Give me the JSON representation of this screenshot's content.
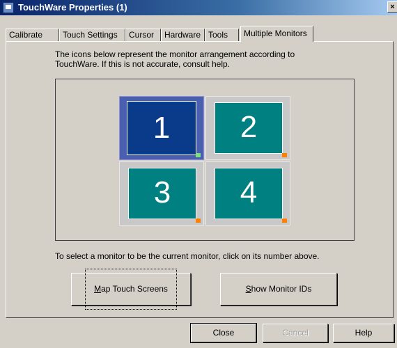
{
  "window": {
    "title": "TouchWare Properties (1)",
    "close_glyph": "×"
  },
  "tabs": [
    "Calibrate",
    "Touch Settings",
    "Cursor",
    "Hardware",
    "Tools",
    "Multiple Monitors"
  ],
  "active_tab": "Multiple Monitors",
  "description": "The icons below represent the monitor arrangement according to TouchWare. If this is not accurate, consult help.",
  "monitors": [
    {
      "label": "1",
      "selected": true
    },
    {
      "label": "2",
      "selected": false
    },
    {
      "label": "3",
      "selected": false
    },
    {
      "label": "4",
      "selected": false
    }
  ],
  "instruction": "To select a monitor to be the current monitor, click on its number above.",
  "buttons": {
    "map_touch_screens": "Map Touch Screens",
    "show_monitor_ids": "Show Monitor IDs",
    "close": "Close",
    "cancel": "Cancel",
    "help": "Help"
  },
  "colors": {
    "selected_monitor": "#0a3a8a",
    "monitor": "#008080",
    "indicator_active": "#80e080",
    "indicator": "#ff8000"
  },
  "icons": {
    "app": "touchware-app-icon",
    "close": "close-icon"
  }
}
